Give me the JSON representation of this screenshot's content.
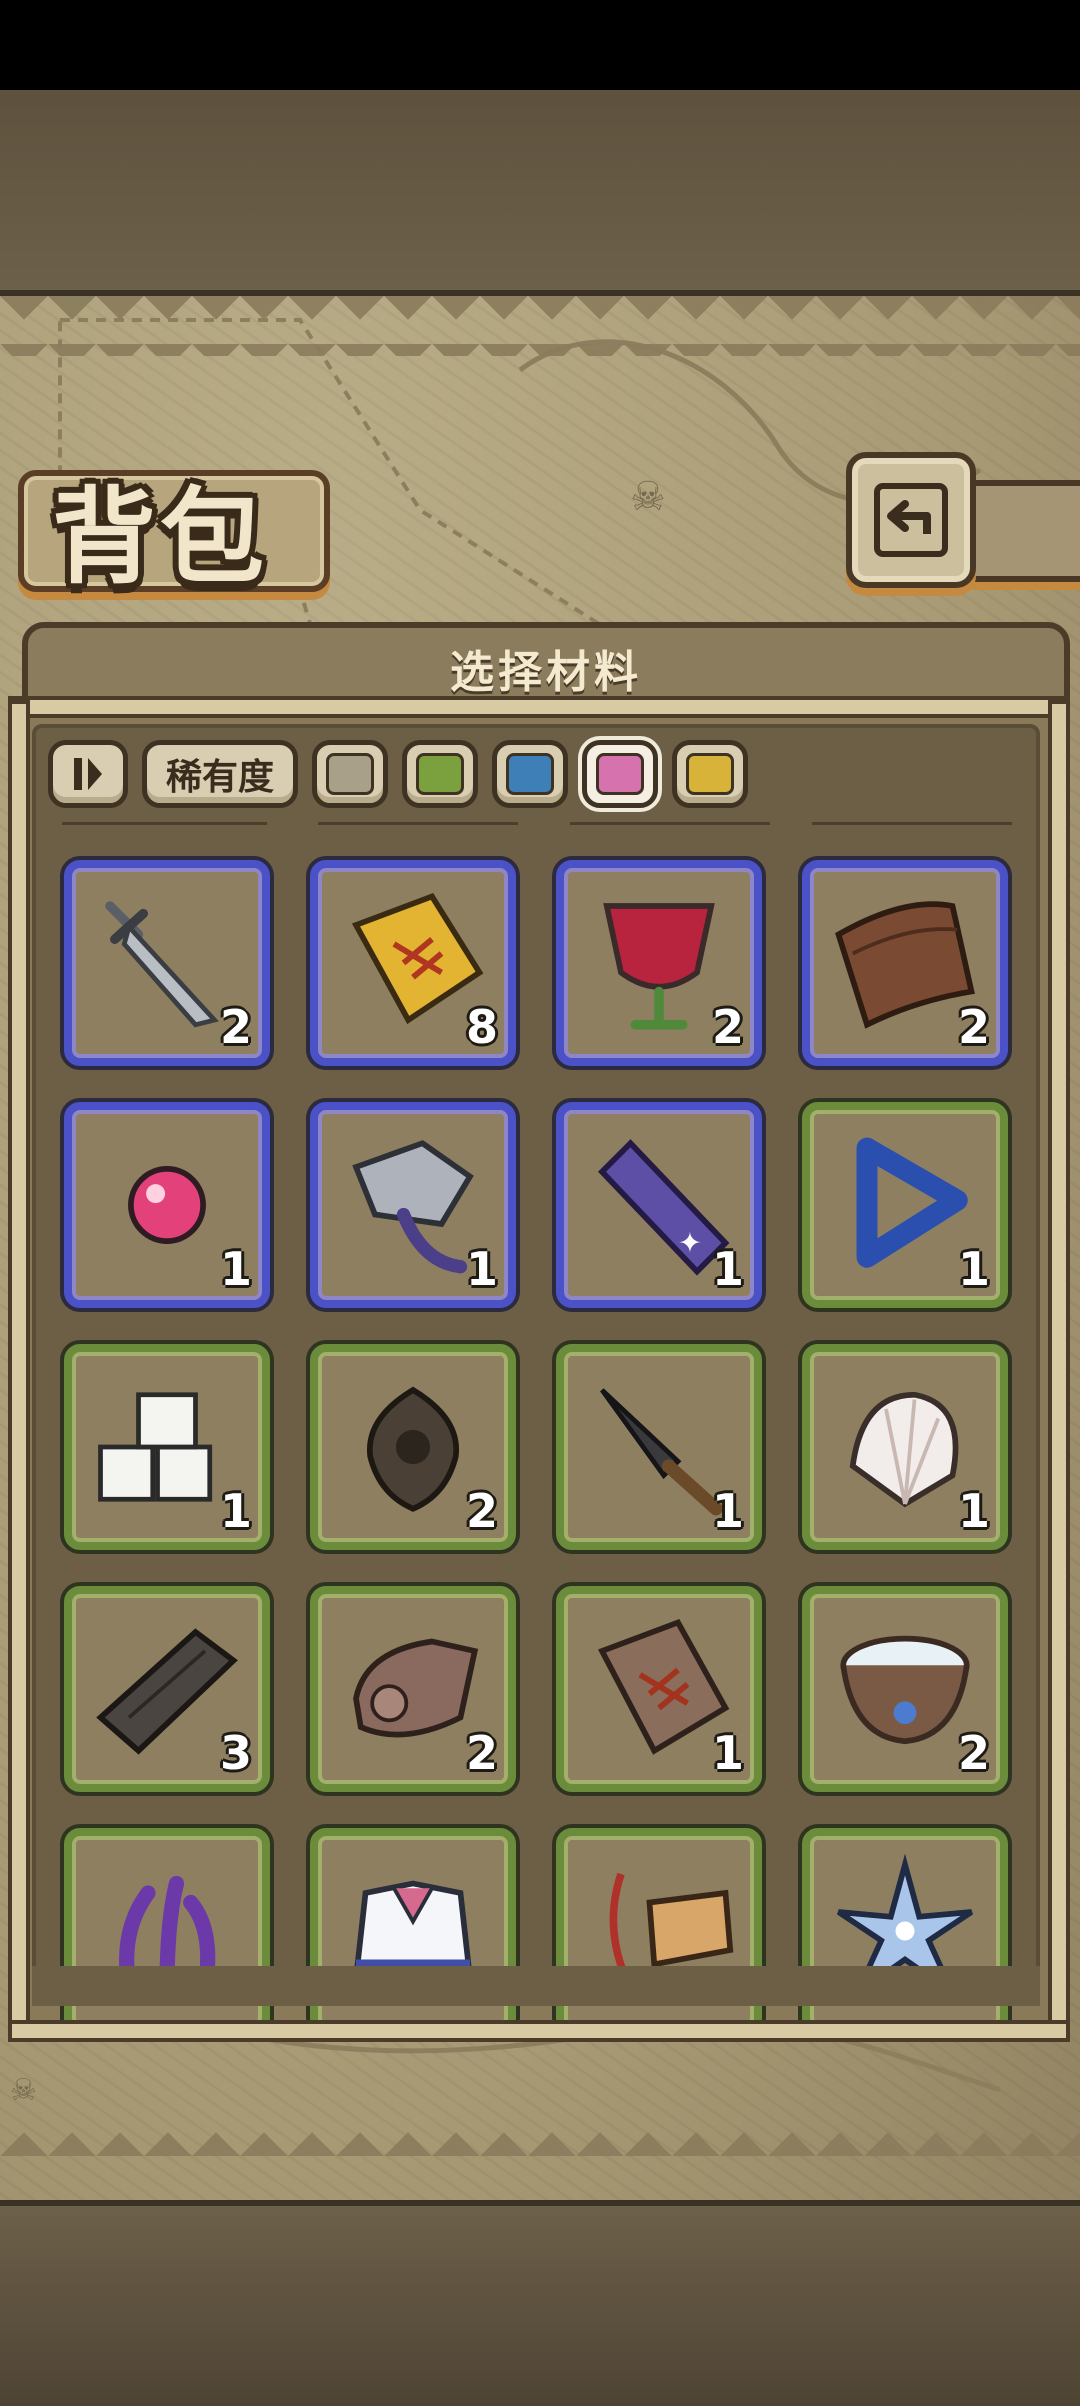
{
  "header": {
    "title": "背包",
    "back_icon": "back-arrow-icon"
  },
  "panel": {
    "title": "选择材料"
  },
  "filters": {
    "sort_icon": "sort-toggle-icon",
    "rarity_label": "稀有度",
    "colors": [
      {
        "name": "gray",
        "hex": "#a9a08a",
        "selected": false
      },
      {
        "name": "green",
        "hex": "#7aa13d",
        "selected": false
      },
      {
        "name": "blue",
        "hex": "#3f7fb8",
        "selected": false
      },
      {
        "name": "pink",
        "hex": "#d672ae",
        "selected": true
      },
      {
        "name": "gold",
        "hex": "#d8b33a",
        "selected": false
      }
    ]
  },
  "items": [
    {
      "icon": "broken-sword-icon",
      "rarity": "blue",
      "count": "2"
    },
    {
      "icon": "gold-fish-tag-icon",
      "rarity": "blue",
      "count": "8"
    },
    {
      "icon": "red-wine-goblet-icon",
      "rarity": "blue",
      "count": "2"
    },
    {
      "icon": "curved-wood-plank-icon",
      "rarity": "blue",
      "count": "2"
    },
    {
      "icon": "pink-pearl-icon",
      "rarity": "blue",
      "count": "1"
    },
    {
      "icon": "fish-skeleton-creature-icon",
      "rarity": "blue",
      "count": "1"
    },
    {
      "icon": "purple-crystal-bar-icon",
      "rarity": "blue",
      "count": "1"
    },
    {
      "icon": "impossible-triangle-icon",
      "rarity": "green",
      "count": "1"
    },
    {
      "icon": "white-cubes-icon",
      "rarity": "green",
      "count": "1"
    },
    {
      "icon": "dark-amulet-icon",
      "rarity": "green",
      "count": "2"
    },
    {
      "icon": "stone-dagger-icon",
      "rarity": "green",
      "count": "1"
    },
    {
      "icon": "seashell-icon",
      "rarity": "green",
      "count": "1"
    },
    {
      "icon": "dark-wood-plank-icon",
      "rarity": "green",
      "count": "3"
    },
    {
      "icon": "conch-horn-icon",
      "rarity": "green",
      "count": "2"
    },
    {
      "icon": "wooden-fish-tag-icon",
      "rarity": "green",
      "count": "1"
    },
    {
      "icon": "paw-print-bowl-icon",
      "rarity": "green",
      "count": "2"
    },
    {
      "icon": "purple-tentacles-icon",
      "rarity": "green",
      "count": ""
    },
    {
      "icon": "sailor-uniform-icon",
      "rarity": "green",
      "count": ""
    },
    {
      "icon": "wooden-charm-tag-icon",
      "rarity": "green",
      "count": ""
    },
    {
      "icon": "blue-star-flower-icon",
      "rarity": "green",
      "count": ""
    }
  ]
}
